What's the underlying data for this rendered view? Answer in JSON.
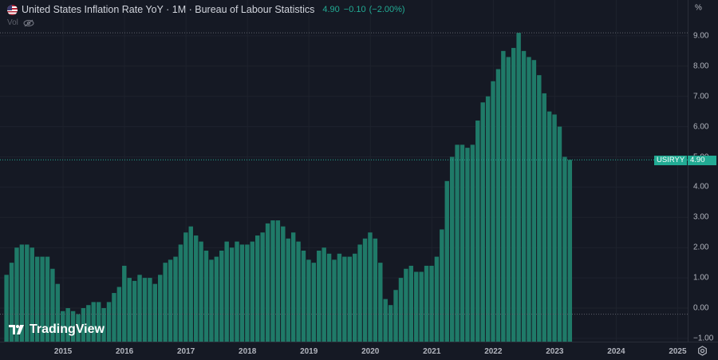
{
  "header": {
    "title": "United States Inflation Rate YoY · 1M · Bureau of Labour Statistics",
    "last": "4.90",
    "change": "−0.10",
    "change_pct": "(−2.00%)",
    "vol_label": "Vol"
  },
  "symbol_tag": "USIRYY",
  "price_tag": "4.90",
  "axis_unit": "%",
  "logo_text": "TradingView",
  "colors": {
    "bar": "#1f7a68",
    "accent": "#22ab94",
    "background": "#151924"
  },
  "chart_data": {
    "type": "bar",
    "title": "United States Inflation Rate YoY",
    "start": "2014-02",
    "frequency": "monthly",
    "values": [
      1.1,
      1.5,
      2.0,
      2.1,
      2.1,
      2.0,
      1.7,
      1.7,
      1.7,
      1.3,
      0.8,
      -0.1,
      0.0,
      -0.1,
      -0.2,
      0.0,
      0.1,
      0.2,
      0.2,
      0.0,
      0.2,
      0.5,
      0.7,
      1.4,
      1.0,
      0.9,
      1.1,
      1.0,
      1.0,
      0.8,
      1.1,
      1.5,
      1.6,
      1.7,
      2.1,
      2.5,
      2.7,
      2.4,
      2.2,
      1.9,
      1.6,
      1.7,
      1.9,
      2.2,
      2.0,
      2.2,
      2.1,
      2.1,
      2.2,
      2.4,
      2.5,
      2.8,
      2.9,
      2.9,
      2.7,
      2.3,
      2.5,
      2.2,
      1.9,
      1.6,
      1.5,
      1.9,
      2.0,
      1.8,
      1.6,
      1.8,
      1.7,
      1.7,
      1.8,
      2.1,
      2.3,
      2.5,
      2.3,
      1.5,
      0.3,
      0.1,
      0.6,
      1.0,
      1.3,
      1.4,
      1.2,
      1.2,
      1.4,
      1.4,
      1.7,
      2.6,
      4.2,
      5.0,
      5.4,
      5.4,
      5.3,
      5.4,
      6.2,
      6.8,
      7.0,
      7.5,
      7.9,
      8.5,
      8.3,
      8.6,
      9.1,
      8.5,
      8.3,
      8.2,
      7.7,
      7.1,
      6.5,
      6.4,
      6.0,
      5.0,
      4.9
    ],
    "y_ticks": [
      "9.00",
      "8.00",
      "7.00",
      "6.00",
      "5.00",
      "4.00",
      "3.00",
      "2.00",
      "1.00",
      "0.00",
      "−1.00"
    ],
    "x_ticks": [
      "2015",
      "2016",
      "2017",
      "2018",
      "2019",
      "2020",
      "2021",
      "2022",
      "2023",
      "2024",
      "2025"
    ],
    "ylim": [
      -1.1,
      10.2
    ],
    "grid": true
  }
}
